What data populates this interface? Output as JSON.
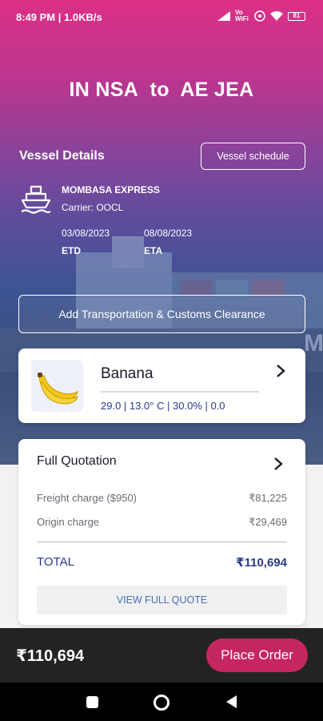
{
  "status_bar": {
    "time": "8:49 PM | 1.0KB/s",
    "battery": "81",
    "network_label": "Vo WiFi"
  },
  "route": {
    "origin": "IN NSA",
    "connector": "to",
    "destination": "AE JEA"
  },
  "vessel": {
    "section_title": "Vessel Details",
    "schedule_button": "Vessel schedule",
    "name": "MOMBASA EXPRESS",
    "carrier": "Carrier: OOCL",
    "etd_date": "03/08/2023",
    "etd_label": "ETD",
    "eta_date": "08/08/2023",
    "eta_label": "ETA"
  },
  "add_transport_button": "Add Transportation & Customs Clearance",
  "product": {
    "name": "Banana",
    "params": "29.0 | 13.0° C | 30.0% | 0.0"
  },
  "quotation": {
    "title": "Full Quotation",
    "rows": [
      {
        "label": "Freight charge ($950)",
        "value": "₹81,225"
      },
      {
        "label": "Origin charge",
        "value": "₹29,469"
      }
    ],
    "total_label": "TOTAL",
    "total_value": "₹110,694",
    "view_button": "VIEW FULL QUOTE"
  },
  "bottom": {
    "price": "₹110,694",
    "place_order": "Place Order"
  },
  "colors": {
    "brand_pink": "#c6265f",
    "accent_blue": "#2a3a8a",
    "gradient_top": "#dd2f86",
    "gradient_bottom": "#3d5494"
  }
}
